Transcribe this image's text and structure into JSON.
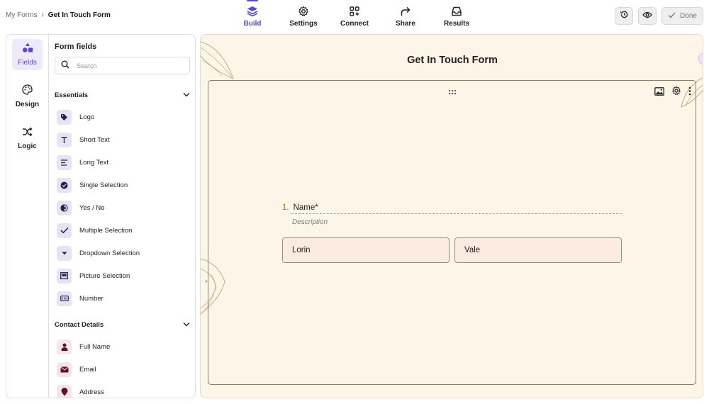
{
  "breadcrumb": {
    "parent": "My Forms",
    "separator": "›",
    "current": "Get In Touch Form"
  },
  "nav": [
    {
      "label": "Build",
      "icon": "layers-icon",
      "active": true
    },
    {
      "label": "Settings",
      "icon": "gear-icon"
    },
    {
      "label": "Connect",
      "icon": "apps-add-icon"
    },
    {
      "label": "Share",
      "icon": "share-arrow-icon"
    },
    {
      "label": "Results",
      "icon": "inbox-icon"
    }
  ],
  "actions": {
    "history_icon": "history-icon",
    "preview_icon": "eye-icon",
    "done_label": "Done"
  },
  "rail": [
    {
      "label": "Fields",
      "icon": "shapes-icon",
      "active": true
    },
    {
      "label": "Design",
      "icon": "palette-icon"
    },
    {
      "label": "Logic",
      "icon": "shuffle-icon"
    }
  ],
  "fields_panel": {
    "title": "Form fields",
    "search_placeholder": "Search",
    "sections": [
      {
        "title": "Essentials",
        "items": [
          {
            "label": "Logo",
            "icon": "tag-icon"
          },
          {
            "label": "Short Text",
            "icon": "text-t-icon"
          },
          {
            "label": "Long Text",
            "icon": "paragraph-icon"
          },
          {
            "label": "Single Selection",
            "icon": "check-circle-icon"
          },
          {
            "label": "Yes / No",
            "icon": "yes-no-icon"
          },
          {
            "label": "Multiple Selection",
            "icon": "checkmark-icon"
          },
          {
            "label": "Dropdown Selection",
            "icon": "dropdown-icon"
          },
          {
            "label": "Picture Selection",
            "icon": "picture-icon"
          },
          {
            "label": "Number",
            "icon": "number-icon"
          }
        ]
      },
      {
        "title": "Contact Details",
        "items": [
          {
            "label": "Full Name",
            "icon": "person-icon"
          },
          {
            "label": "Email",
            "icon": "mail-icon"
          },
          {
            "label": "Address",
            "icon": "location-icon"
          }
        ]
      }
    ]
  },
  "form": {
    "title": "Get In Touch Form",
    "question": {
      "number": "1.",
      "label": "Name*",
      "description": "Description"
    },
    "inputs": [
      {
        "value": "Lorin"
      },
      {
        "value": "Vale"
      }
    ]
  },
  "colors": {
    "accent": "#5b47c9",
    "canvas_bg": "#fdf6e8",
    "input_bg": "#fcebe0",
    "number_gold": "#a27e2a"
  }
}
